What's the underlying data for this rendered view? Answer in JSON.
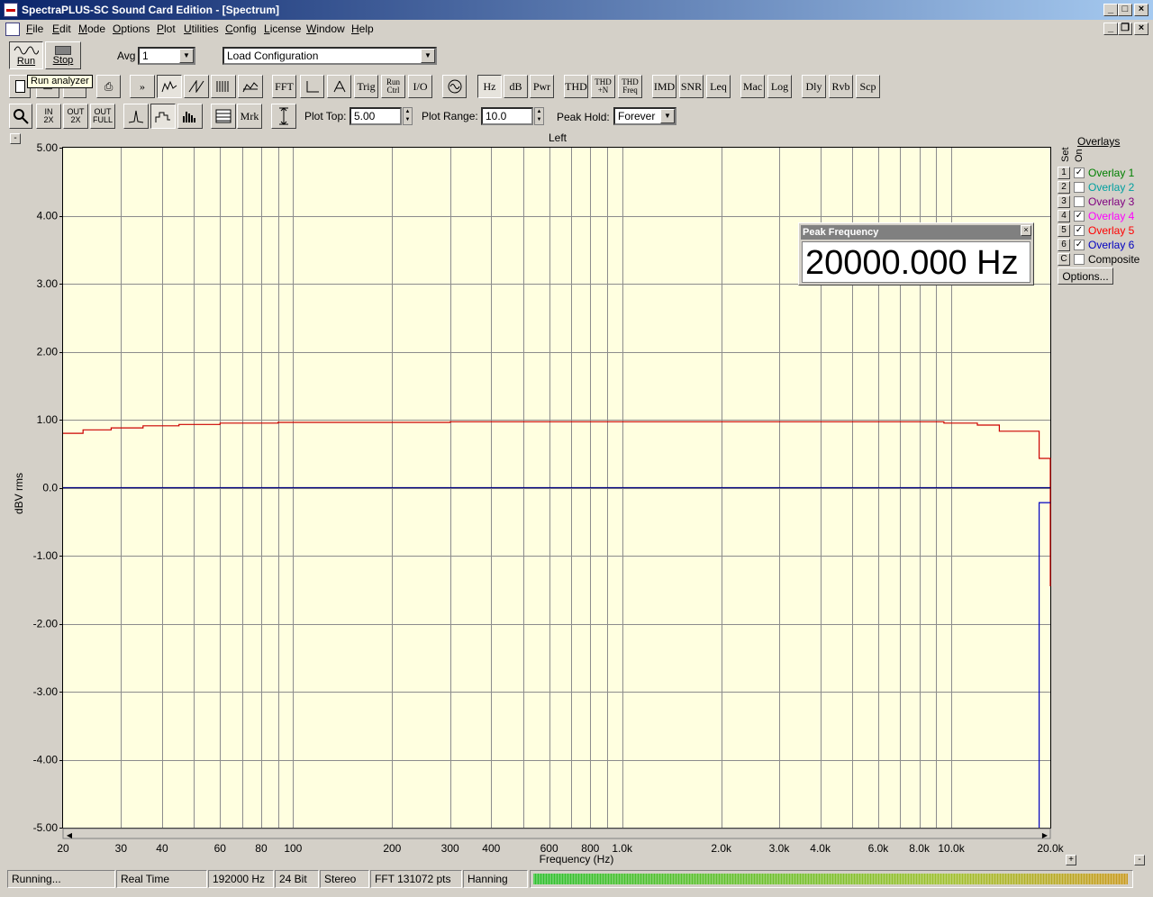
{
  "window": {
    "title": "SpectraPLUS-SC Sound Card Edition - [Spectrum]"
  },
  "menu": [
    "File",
    "Edit",
    "Mode",
    "Options",
    "Plot",
    "Utilities",
    "Config",
    "License",
    "Window",
    "Help"
  ],
  "toolbar1": {
    "run_label": "Run",
    "stop_label": "Stop",
    "avg_label": "Avg",
    "avg_value": "1",
    "config_value": "Load Configuration"
  },
  "tooltip": "Run analyzer",
  "toolbar2": {
    "buttons": [
      "FFT",
      "Trig",
      "Run Ctrl",
      "I/O",
      "Hz",
      "dB",
      "Pwr",
      "THD",
      "THD +N",
      "THD Freq",
      "IMD",
      "SNR",
      "Leq",
      "Mac",
      "Log",
      "Dly",
      "Rvb",
      "Scp"
    ]
  },
  "toolbar3": {
    "mrk_label": "Mrk",
    "plot_top_label": "Plot Top:",
    "plot_top_value": "5.00",
    "plot_range_label": "Plot Range:",
    "plot_range_value": "10.0",
    "peak_hold_label": "Peak Hold:",
    "peak_hold_value": "Forever"
  },
  "overlays": {
    "header": "Overlays",
    "set_label": "Set",
    "on_label": "On",
    "items": [
      {
        "num": "1",
        "name": "Overlay 1",
        "checked": true,
        "color": "#008000"
      },
      {
        "num": "2",
        "name": "Overlay 2",
        "checked": false,
        "color": "#00a0a0"
      },
      {
        "num": "3",
        "name": "Overlay 3",
        "checked": false,
        "color": "#800080"
      },
      {
        "num": "4",
        "name": "Overlay 4",
        "checked": true,
        "color": "#ff00ff"
      },
      {
        "num": "5",
        "name": "Overlay 5",
        "checked": true,
        "color": "#ff0000"
      },
      {
        "num": "6",
        "name": "Overlay 6",
        "checked": true,
        "color": "#0000c0"
      },
      {
        "num": "C",
        "name": "Composite",
        "checked": false,
        "color": "#000000"
      }
    ],
    "options_label": "Options..."
  },
  "peak_window": {
    "title": "Peak Frequency",
    "value": "20000.000 Hz"
  },
  "status": {
    "state": "Running...",
    "mode": "Real Time",
    "rate": "192000 Hz",
    "bits": "24 Bit",
    "channels": "Stereo",
    "fft": "FFT 131072 pts",
    "window": "Hanning"
  },
  "chart_data": {
    "type": "line",
    "title": "Left",
    "xlabel": "Frequency (Hz)",
    "ylabel": "dBV rms",
    "xscale": "log",
    "xlim": [
      20,
      20000
    ],
    "ylim": [
      -5,
      5
    ],
    "grid": true,
    "y_ticks": [
      "5.00",
      "4.00",
      "3.00",
      "2.00",
      "1.00",
      "0.0",
      "-1.00",
      "-2.00",
      "-3.00",
      "-4.00",
      "-5.00"
    ],
    "y_tick_values": [
      5,
      4,
      3,
      2,
      1,
      0,
      -1,
      -2,
      -3,
      -4,
      -5
    ],
    "x_ticks": [
      "20",
      "30",
      "40",
      "60",
      "80",
      "100",
      "200",
      "300",
      "400",
      "600",
      "800",
      "1.0k",
      "2.0k",
      "3.0k",
      "4.0k",
      "6.0k",
      "8.0k",
      "10.0k",
      "20.0k"
    ],
    "x_tick_values": [
      20,
      30,
      40,
      60,
      80,
      100,
      200,
      300,
      400,
      600,
      800,
      1000,
      2000,
      3000,
      4000,
      6000,
      8000,
      10000,
      20000
    ],
    "series": [
      {
        "color": "#cc0000",
        "x": [
          20,
          23,
          23,
          28,
          28,
          35,
          35,
          45,
          45,
          60,
          60,
          90,
          90,
          300,
          300,
          9500,
          9500,
          12000,
          12000,
          14000,
          14000,
          18500,
          18500,
          20000,
          20000
        ],
        "y": [
          0.8,
          0.8,
          0.85,
          0.85,
          0.88,
          0.88,
          0.91,
          0.91,
          0.93,
          0.93,
          0.95,
          0.95,
          0.96,
          0.96,
          0.97,
          0.97,
          0.95,
          0.95,
          0.92,
          0.92,
          0.83,
          0.83,
          0.43,
          0.43,
          -1.45
        ]
      },
      {
        "color": "#000080",
        "x": [
          20,
          20000
        ],
        "y": [
          0.0,
          0.0
        ]
      },
      {
        "color": "#0000c0",
        "x": [
          18500,
          18500,
          20000
        ],
        "y": [
          -5.0,
          -0.22,
          -0.22
        ]
      }
    ]
  }
}
